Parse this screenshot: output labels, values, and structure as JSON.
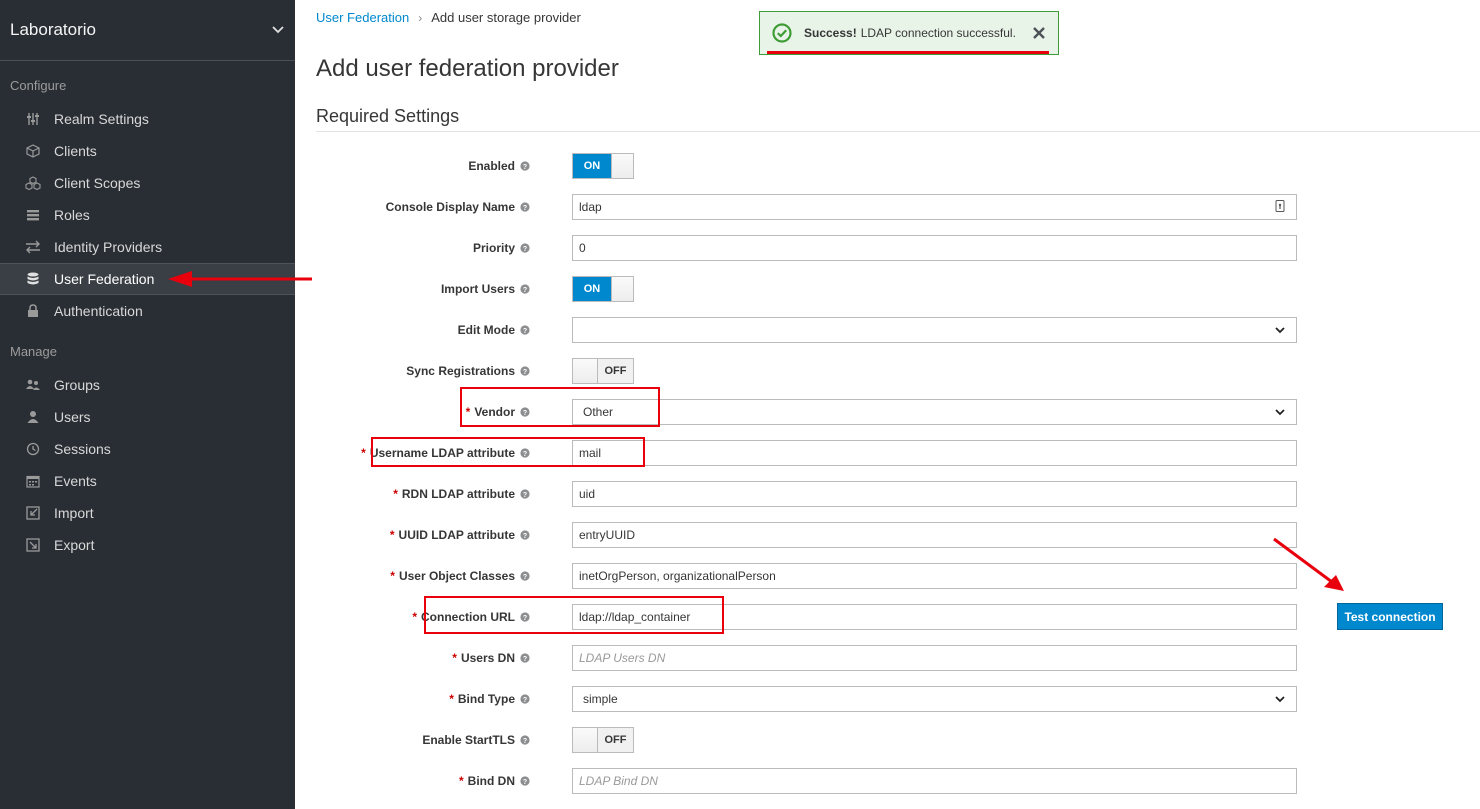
{
  "sidebar": {
    "realm": "Laboratorio",
    "configure_title": "Configure",
    "manage_title": "Manage",
    "configure_items": [
      {
        "label": "Realm Settings",
        "icon": "sliders-icon"
      },
      {
        "label": "Clients",
        "icon": "cube-icon"
      },
      {
        "label": "Client Scopes",
        "icon": "cubes-icon"
      },
      {
        "label": "Roles",
        "icon": "list-icon"
      },
      {
        "label": "Identity Providers",
        "icon": "exchange-icon"
      },
      {
        "label": "User Federation",
        "icon": "database-icon",
        "active": true
      },
      {
        "label": "Authentication",
        "icon": "lock-icon"
      }
    ],
    "manage_items": [
      {
        "label": "Groups",
        "icon": "users-icon"
      },
      {
        "label": "Users",
        "icon": "user-icon"
      },
      {
        "label": "Sessions",
        "icon": "clock-icon"
      },
      {
        "label": "Events",
        "icon": "calendar-icon"
      },
      {
        "label": "Import",
        "icon": "import-icon"
      },
      {
        "label": "Export",
        "icon": "export-icon"
      }
    ]
  },
  "breadcrumb": {
    "parent": "User Federation",
    "separator": "›",
    "current": "Add user storage provider"
  },
  "page_title": "Add user federation provider",
  "section_title": "Required Settings",
  "toast": {
    "strong": "Success!",
    "message": "LDAP connection successful.",
    "close": "✕"
  },
  "form": {
    "enabled": {
      "label": "Enabled",
      "value": "ON"
    },
    "console_display_name": {
      "label": "Console Display Name",
      "value": "ldap"
    },
    "priority": {
      "label": "Priority",
      "value": "0"
    },
    "import_users": {
      "label": "Import Users",
      "value": "ON"
    },
    "edit_mode": {
      "label": "Edit Mode",
      "value": ""
    },
    "sync_registrations": {
      "label": "Sync Registrations",
      "value": "OFF"
    },
    "vendor": {
      "label": "Vendor",
      "value": "Other"
    },
    "username_ldap_attribute": {
      "label": "Username LDAP attribute",
      "value": "mail"
    },
    "rdn_ldap_attribute": {
      "label": "RDN LDAP attribute",
      "value": "uid"
    },
    "uuid_ldap_attribute": {
      "label": "UUID LDAP attribute",
      "value": "entryUUID"
    },
    "user_object_classes": {
      "label": "User Object Classes",
      "value": "inetOrgPerson, organizationalPerson"
    },
    "connection_url": {
      "label": "Connection URL",
      "value": "ldap://ldap_container"
    },
    "users_dn": {
      "label": "Users DN",
      "placeholder": "LDAP Users DN"
    },
    "bind_type": {
      "label": "Bind Type",
      "value": "simple"
    },
    "enable_starttls": {
      "label": "Enable StartTLS",
      "value": "OFF"
    },
    "bind_dn": {
      "label": "Bind DN",
      "placeholder": "LDAP Bind DN"
    }
  },
  "test_connection_label": "Test connection",
  "colors": {
    "sidebar_bg": "#292e34",
    "accent": "#0088ce",
    "success_border": "#3f9c35",
    "annotation_red": "#e8000d"
  }
}
